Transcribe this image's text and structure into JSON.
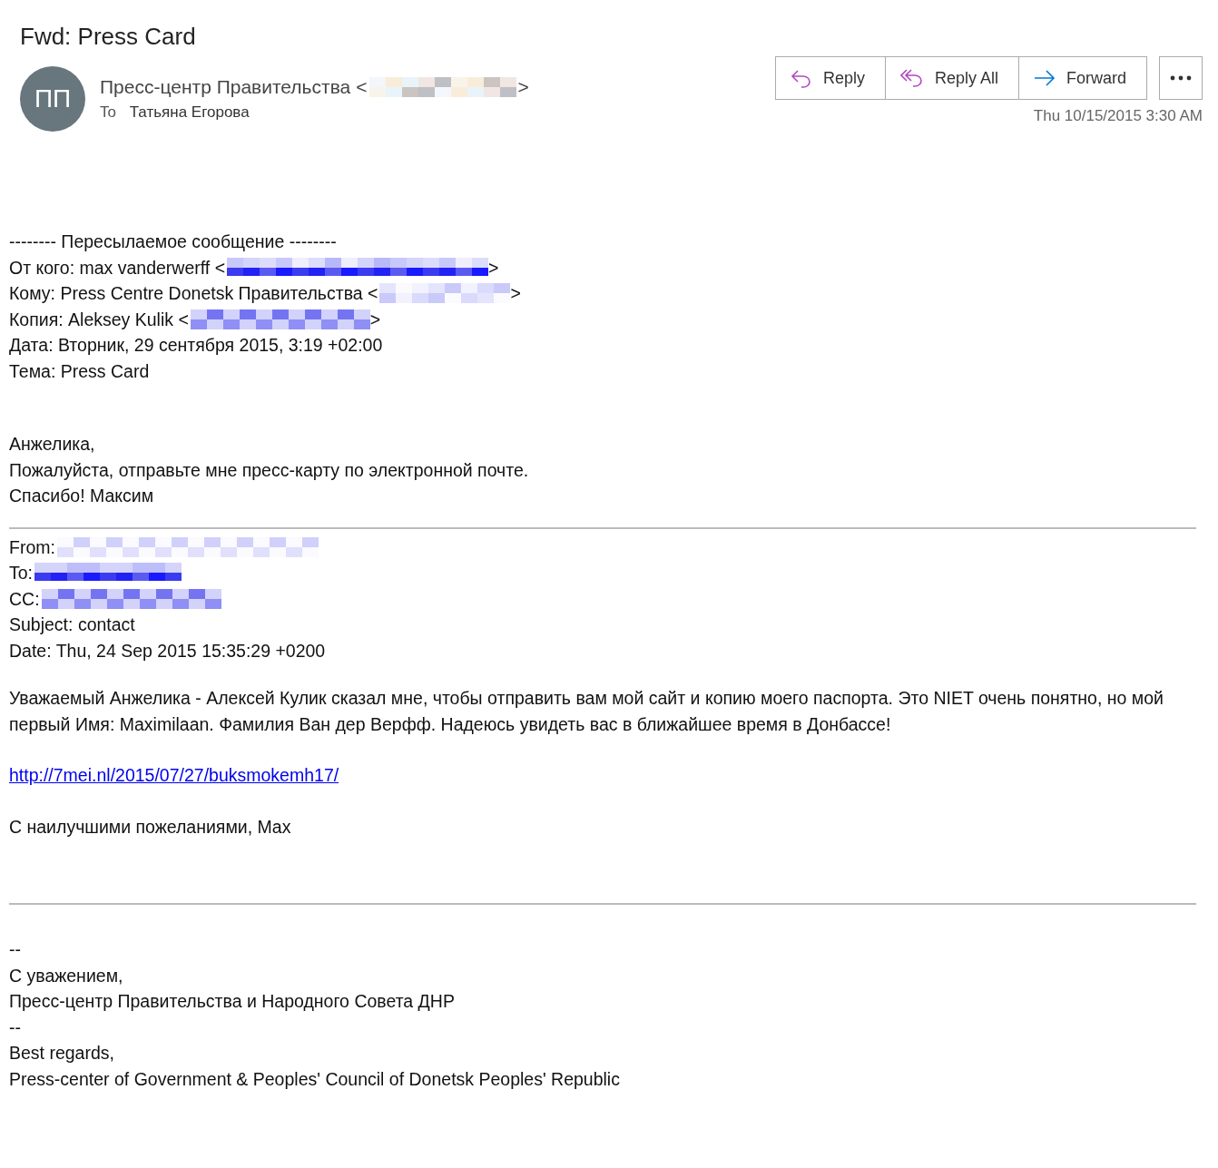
{
  "message": {
    "subject": "Fwd: Press Card",
    "sender": {
      "initials": "ПП",
      "name": "Пресс-центр Правительства",
      "open": "<",
      "redacted": true,
      "close": ">"
    },
    "to_label": "To",
    "recipient": "Татьяна Егорова",
    "date": "Thu 10/15/2015 3:30 AM"
  },
  "actions": [
    {
      "kind": "reply",
      "label": "Reply"
    },
    {
      "kind": "reply_all",
      "label": "Reply All"
    },
    {
      "kind": "forward",
      "label": "Forward"
    }
  ],
  "body": [
    {
      "kind": "lines",
      "lines": [
        {
          "text": "-------- Пересылаемое сообщение --------"
        },
        {
          "text": "От кого: max vanderwerff <",
          "redacted": true,
          "close": ">"
        },
        {
          "text": "Кому: Press Centre Donetsk Правительства <",
          "redacted": true,
          "close": ">"
        },
        {
          "text": "Копия: Aleksey Kulik <",
          "redacted": true,
          "close": ">"
        },
        {
          "text": "Дата: Вторник, 29 сентября 2015, 3:19 +02:00"
        },
        {
          "text": "Тема: Press Card"
        }
      ]
    },
    {
      "kind": "lines",
      "lines": [
        {
          "text": "Анжелика,"
        },
        {
          "text": "Пожалуйста, отправьте мне пресс-карту по электронной почте."
        },
        {
          "text": "Спасибо! Максим"
        }
      ]
    },
    {
      "kind": "rule"
    },
    {
      "kind": "lines",
      "lines": [
        {
          "text": "From:",
          "redacted": true
        },
        {
          "text": "To:",
          "redacted": true
        },
        {
          "text": "CC:",
          "redacted": true
        },
        {
          "text": "Subject: contact"
        },
        {
          "text": "Date: Thu, 24 Sep 2015 15:35:29 +0200"
        }
      ]
    },
    {
      "kind": "paragraph",
      "text": "Уважаемый Анжелика - Алексей Кулик сказал мне, чтобы отправить вам мой сайт и копию моего паспорта. Это NIET очень понятно, но мой первый Имя: Maximilaan. Фамилия Ван дер Верфф. Надеюсь увидеть вас в ближайшее время в Донбассе!"
    },
    {
      "kind": "link",
      "text": "http://7mei.nl/2015/07/27/buksmokemh17/"
    },
    {
      "kind": "paragraph",
      "text": "С наилучшими пожеланиями, Max"
    },
    {
      "kind": "rule"
    },
    {
      "kind": "lines",
      "lines": [
        {
          "text": "--"
        },
        {
          "text": "С уважением,"
        },
        {
          "text": "Пресс-центр Правительства и Народного Совета ДНР"
        },
        {
          "text": "--"
        },
        {
          "text": "Best regards,"
        },
        {
          "text": "Press-center of Government & Peoples' Council of Donetsk Peoples' Republic"
        }
      ]
    }
  ]
}
